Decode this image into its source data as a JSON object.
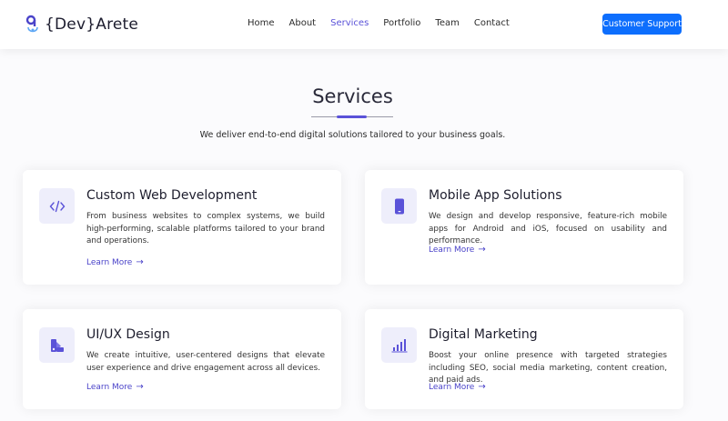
{
  "header": {
    "logo_text": "{Dev}Arete",
    "nav": [
      "Home",
      "About",
      "Services",
      "Portfolio",
      "Team",
      "Contact"
    ],
    "active_nav": "Services",
    "support_button": "Customer Support"
  },
  "section": {
    "title": "Services",
    "subtitle": "We deliver end-to-end digital solutions tailored to your business goals."
  },
  "cards": [
    {
      "icon": "code-icon",
      "title": "Custom Web Development",
      "description": "From business websites to complex systems, we build high-performing, scalable platforms tailored to your brand and operations.",
      "link": "Learn More"
    },
    {
      "icon": "mobile-icon",
      "title": "Mobile App Solutions",
      "description": "We design and develop responsive, feature-rich mobile apps for Android and iOS, focused on usability and performance.",
      "link": "Learn More"
    },
    {
      "icon": "palette-icon",
      "title": "UI/UX Design",
      "description": "We create intuitive, user-centered designs that elevate user experience and drive engagement across all devices.",
      "link": "Learn More"
    },
    {
      "icon": "bar-chart-icon",
      "title": "Digital Marketing",
      "description": "Boost your online presence with targeted strategies including SEO, social media marketing, content creation, and paid ads.",
      "link": "Learn More"
    }
  ],
  "colors": {
    "accent": "#5a52d8",
    "button": "#0d6efd",
    "icon_bg": "#eeeefb"
  }
}
